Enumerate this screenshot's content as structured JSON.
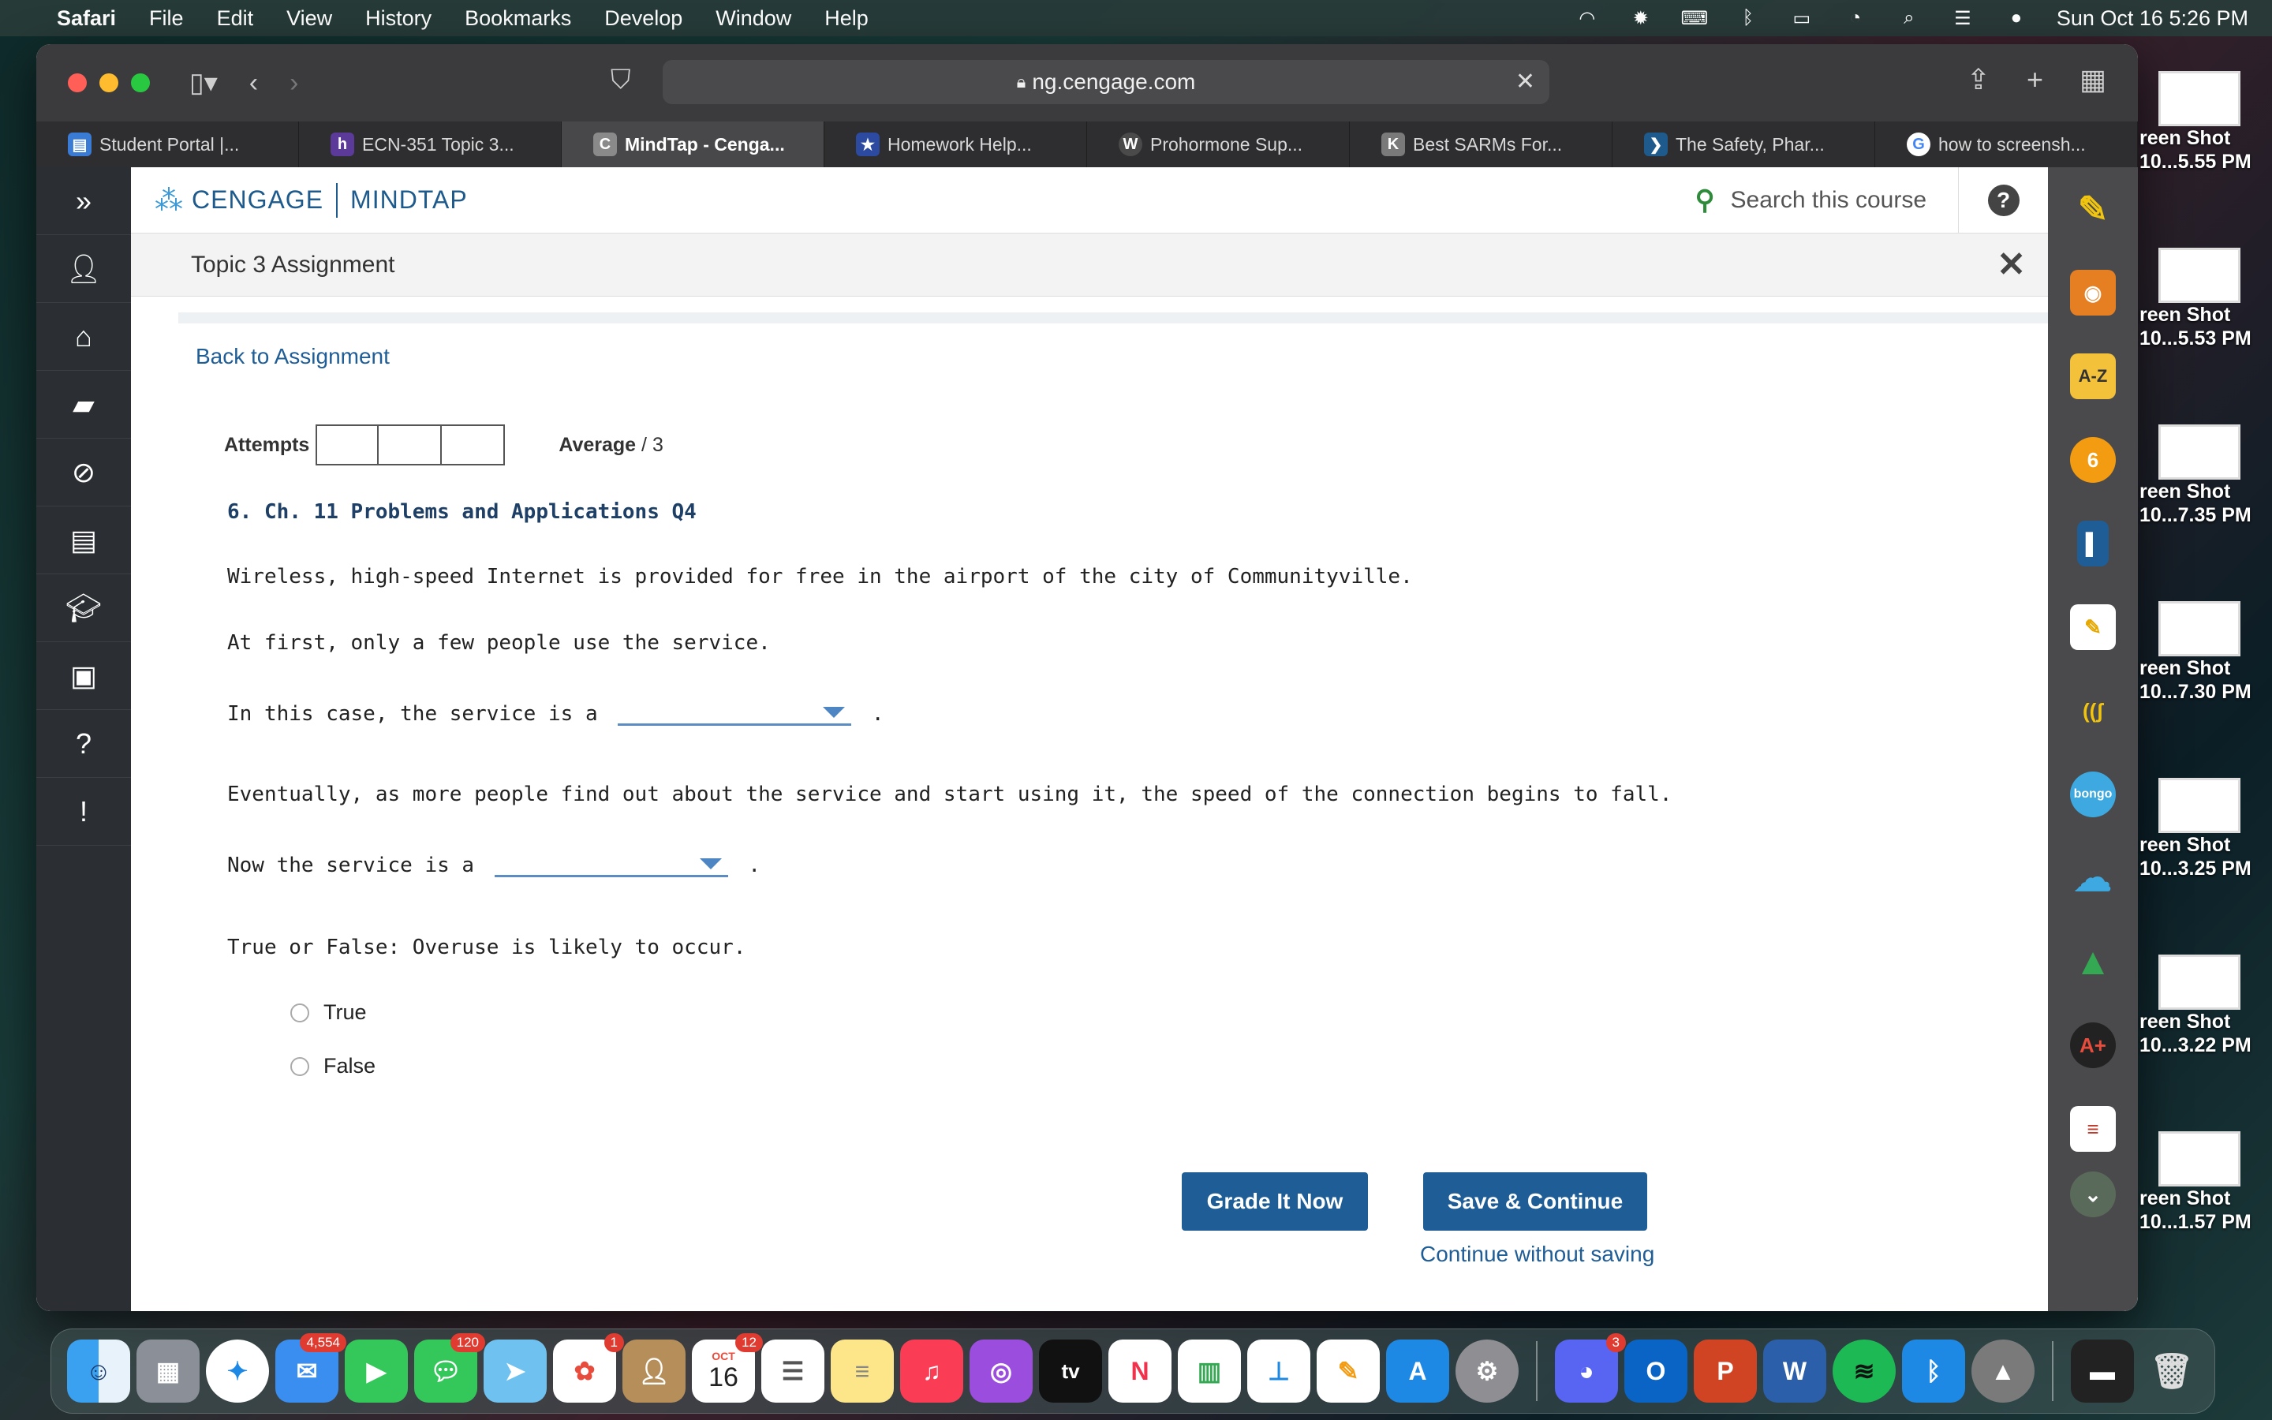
{
  "menubar": {
    "app": "Safari",
    "items": [
      "File",
      "Edit",
      "View",
      "History",
      "Bookmarks",
      "Develop",
      "Window",
      "Help"
    ],
    "clock": "Sun Oct 16  5:26 PM"
  },
  "browser": {
    "url": "ng.cengage.com",
    "tabs": [
      {
        "label": "Student Portal |...",
        "icon": "student-portal-icon",
        "color": "#3a7bd5",
        "glyph": "▤"
      },
      {
        "label": "ECN-351 Topic 3...",
        "icon": "h-icon",
        "color": "#5c3a9a",
        "glyph": "h"
      },
      {
        "label": "MindTap - Cenga...",
        "icon": "c-icon",
        "color": "#8a8a8a",
        "glyph": "C"
      },
      {
        "label": "Homework Help...",
        "icon": "star-icon",
        "color": "#2c4aa0",
        "glyph": "★"
      },
      {
        "label": "Prohormone Sup...",
        "icon": "wordpress-icon",
        "color": "#4a4a4a",
        "glyph": "W"
      },
      {
        "label": "Best SARMs For...",
        "icon": "k-icon",
        "color": "#7a7a7a",
        "glyph": "K"
      },
      {
        "label": "The Safety, Phar...",
        "icon": "arrow-icon",
        "color": "#1e5b8c",
        "glyph": "❯"
      },
      {
        "label": "how to screensh...",
        "icon": "google-icon",
        "color": "#ffffff",
        "glyph": "G"
      }
    ]
  },
  "app": {
    "brand_left": "CENGAGE",
    "brand_right": "MINDTAP",
    "search_placeholder": "Search this course",
    "assignment_title": "Topic 3 Assignment",
    "back_link": "Back to Assignment",
    "attempts_label": "Attempts",
    "average_label": "Average",
    "average_value": "/ 3",
    "question_title": "6. Ch. 11 Problems and Applications Q4",
    "paragraphs": {
      "p1": "Wireless, high-speed Internet is provided for free in the airport of the city of Communityville.",
      "p2": "At first, only a few people use the service.",
      "p3_prefix": "In this case, the service is a",
      "p4": "Eventually, as more people find out about the service and start using it, the speed of the connection begins to fall.",
      "p5_prefix": "Now the service is a",
      "p6": "True or False: Overuse is likely to occur."
    },
    "dropdown1_value": "",
    "dropdown2_value": "",
    "options": [
      "True",
      "False"
    ],
    "grade_button": "Grade It Now",
    "save_button": "Save & Continue",
    "continue_link": "Continue without saving"
  },
  "desktop_shots": [
    {
      "line1": "reen Shot",
      "line2": "10...5.55 PM"
    },
    {
      "line1": "reen Shot",
      "line2": "10...5.53 PM"
    },
    {
      "line1": "reen Shot",
      "line2": "10...7.35 PM"
    },
    {
      "line1": "reen Shot",
      "line2": "10...7.30 PM"
    },
    {
      "line1": "reen Shot",
      "line2": "10...3.25 PM"
    },
    {
      "line1": "reen Shot",
      "line2": "10...3.22 PM"
    },
    {
      "line1": "reen Shot",
      "line2": "10...1.57 PM"
    }
  ],
  "dock": {
    "mail_badge": "4,554",
    "messages_badge": "120",
    "photos_badge": "1",
    "calendar_month": "OCT",
    "calendar_day": "16",
    "calendar_badge": "12",
    "discord_badge": "3",
    "tv_label": "tv"
  },
  "colors": {
    "accent": "#1f5d96",
    "nav": "#2b2f33",
    "search_icon": "#2e8b3a"
  }
}
